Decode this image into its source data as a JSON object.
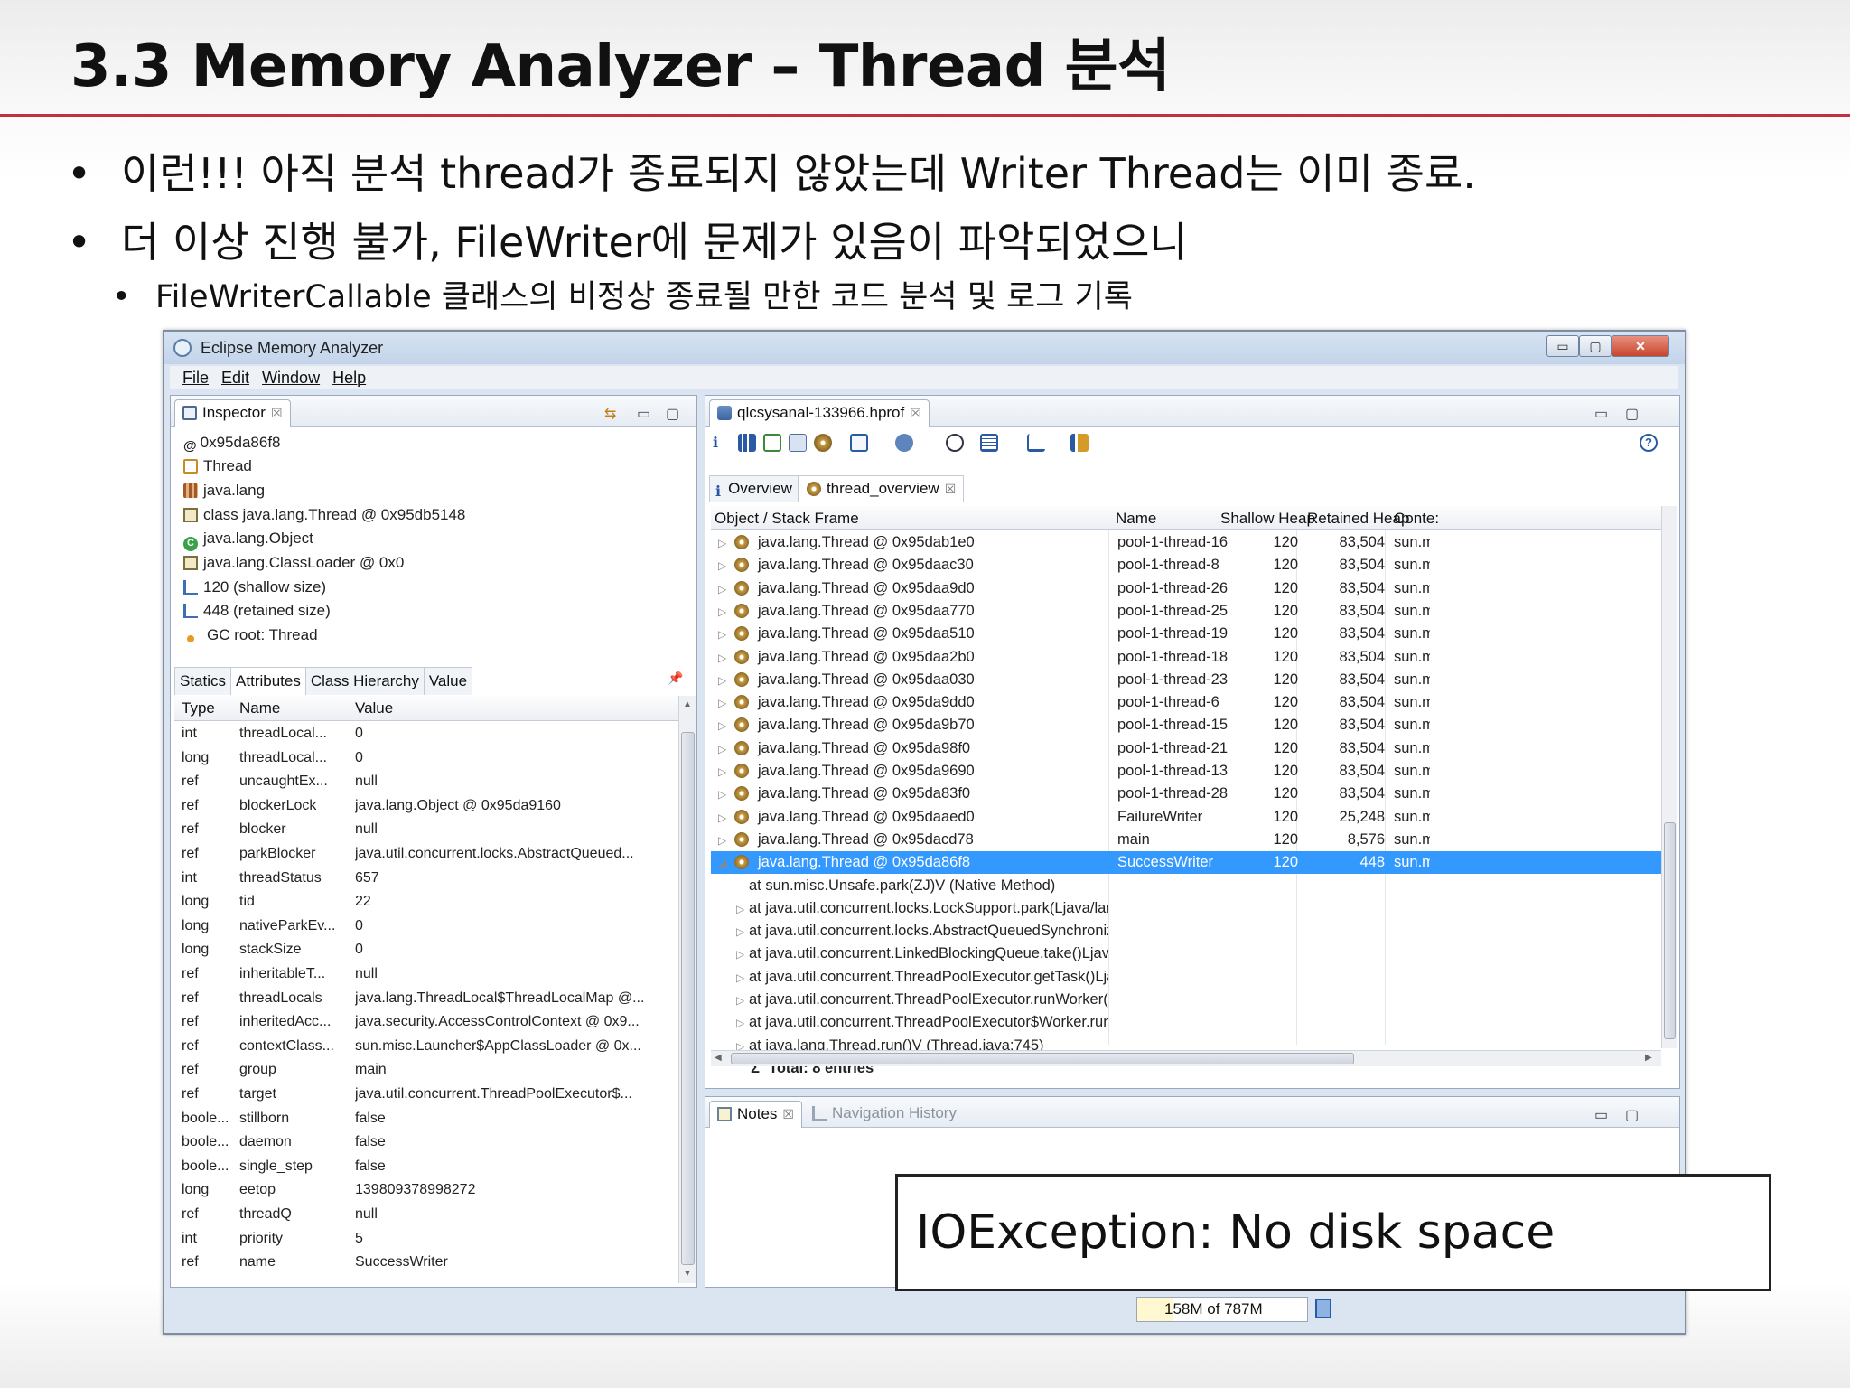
{
  "slide": {
    "title": "3.3 Memory Analyzer – Thread 분석",
    "bullets": [
      "이런!!! 아직 분석 thread가 종료되지 않았는데 Writer Thread는 이미 종료.",
      "더 이상 진행 불가, FileWriter에 문제가 있음이 파악되었으니"
    ],
    "sub_bullet": "FileWriterCallable 클래스의 비정상 종료될 만한 코드 분석 및 로그 기록",
    "bullet_symbol": "•",
    "accent_color": "#c4303d"
  },
  "window": {
    "title": "Eclipse Memory Analyzer",
    "controls": {
      "minimize": "▭",
      "maximize": "▢",
      "close": "✕"
    },
    "menu": [
      "File",
      "Edit",
      "Window",
      "Help"
    ]
  },
  "inspector": {
    "tab_label": "Inspector",
    "items": [
      {
        "icon": "address-icon",
        "glyph": "@",
        "text": "0x95da86f8"
      },
      {
        "icon": "thread-icon",
        "text": "Thread"
      },
      {
        "icon": "package-icon",
        "text": "java.lang"
      },
      {
        "icon": "class-icon",
        "text": "class java.lang.Thread @ 0x95db5148"
      },
      {
        "icon": "object-icon",
        "text": "java.lang.Object"
      },
      {
        "icon": "classloader-icon",
        "text": "java.lang.ClassLoader @ 0x0"
      },
      {
        "icon": "size-icon",
        "text": "120 (shallow size)"
      },
      {
        "icon": "size-icon",
        "text": "448 (retained size)"
      },
      {
        "icon": "gc-root-icon",
        "text": "GC root: Thread"
      }
    ],
    "subtabs": [
      "Statics",
      "Attributes",
      "Class Hierarchy",
      "Value"
    ],
    "active_subtab": "Attributes",
    "columns": [
      "Type",
      "Name",
      "Value"
    ],
    "rows": [
      [
        "int",
        "threadLocal...",
        "0"
      ],
      [
        "long",
        "threadLocal...",
        "0"
      ],
      [
        "ref",
        "uncaughtEx...",
        "null"
      ],
      [
        "ref",
        "blockerLock",
        "java.lang.Object @ 0x95da9160"
      ],
      [
        "ref",
        "blocker",
        "null"
      ],
      [
        "ref",
        "parkBlocker",
        "java.util.concurrent.locks.AbstractQueued..."
      ],
      [
        "int",
        "threadStatus",
        "657"
      ],
      [
        "long",
        "tid",
        "22"
      ],
      [
        "long",
        "nativeParkEv...",
        "0"
      ],
      [
        "long",
        "stackSize",
        "0"
      ],
      [
        "ref",
        "inheritableT...",
        "null"
      ],
      [
        "ref",
        "threadLocals",
        "java.lang.ThreadLocal$ThreadLocalMap @..."
      ],
      [
        "ref",
        "inheritedAcc...",
        "java.security.AccessControlContext @ 0x9..."
      ],
      [
        "ref",
        "contextClass...",
        "sun.misc.Launcher$AppClassLoader @ 0x..."
      ],
      [
        "ref",
        "group",
        "main"
      ],
      [
        "ref",
        "target",
        "java.util.concurrent.ThreadPoolExecutor$..."
      ],
      [
        "boole...",
        "stillborn",
        "false"
      ],
      [
        "boole...",
        "daemon",
        "false"
      ],
      [
        "boole...",
        "single_step",
        "false"
      ],
      [
        "long",
        "eetop",
        "139809378998272"
      ],
      [
        "ref",
        "threadQ",
        "null"
      ],
      [
        "int",
        "priority",
        "5"
      ],
      [
        "ref",
        "name",
        "SuccessWriter"
      ]
    ]
  },
  "editor": {
    "tab_label": "qlcsysanal-133966.hprof",
    "subtabs": [
      "Overview",
      "thread_overview"
    ],
    "active_subtab": "thread_overview",
    "columns": [
      "Object / Stack Frame",
      "Name",
      "Shallow Heap",
      "Retained Heap",
      "Conte:"
    ],
    "threads": [
      {
        "obj": "java.lang.Thread @ 0x95dab1e0",
        "name": "pool-1-thread-16",
        "shallow": "120",
        "retained": "83,504",
        "ctx": "sun.mi"
      },
      {
        "obj": "java.lang.Thread @ 0x95daac30",
        "name": "pool-1-thread-8",
        "shallow": "120",
        "retained": "83,504",
        "ctx": "sun.mi"
      },
      {
        "obj": "java.lang.Thread @ 0x95daa9d0",
        "name": "pool-1-thread-26",
        "shallow": "120",
        "retained": "83,504",
        "ctx": "sun.mi"
      },
      {
        "obj": "java.lang.Thread @ 0x95daa770",
        "name": "pool-1-thread-25",
        "shallow": "120",
        "retained": "83,504",
        "ctx": "sun.mi"
      },
      {
        "obj": "java.lang.Thread @ 0x95daa510",
        "name": "pool-1-thread-19",
        "shallow": "120",
        "retained": "83,504",
        "ctx": "sun.mi"
      },
      {
        "obj": "java.lang.Thread @ 0x95daa2b0",
        "name": "pool-1-thread-18",
        "shallow": "120",
        "retained": "83,504",
        "ctx": "sun.mi"
      },
      {
        "obj": "java.lang.Thread @ 0x95daa030",
        "name": "pool-1-thread-23",
        "shallow": "120",
        "retained": "83,504",
        "ctx": "sun.mi"
      },
      {
        "obj": "java.lang.Thread @ 0x95da9dd0",
        "name": "pool-1-thread-6",
        "shallow": "120",
        "retained": "83,504",
        "ctx": "sun.mi"
      },
      {
        "obj": "java.lang.Thread @ 0x95da9b70",
        "name": "pool-1-thread-15",
        "shallow": "120",
        "retained": "83,504",
        "ctx": "sun.mi"
      },
      {
        "obj": "java.lang.Thread @ 0x95da98f0",
        "name": "pool-1-thread-21",
        "shallow": "120",
        "retained": "83,504",
        "ctx": "sun.mi"
      },
      {
        "obj": "java.lang.Thread @ 0x95da9690",
        "name": "pool-1-thread-13",
        "shallow": "120",
        "retained": "83,504",
        "ctx": "sun.mi"
      },
      {
        "obj": "java.lang.Thread @ 0x95da83f0",
        "name": "pool-1-thread-28",
        "shallow": "120",
        "retained": "83,504",
        "ctx": "sun.mi"
      },
      {
        "obj": "java.lang.Thread @ 0x95daaed0",
        "name": "FailureWriter",
        "shallow": "120",
        "retained": "25,248",
        "ctx": "sun.mi"
      },
      {
        "obj": "java.lang.Thread @ 0x95dacd78",
        "name": "main",
        "shallow": "120",
        "retained": "8,576",
        "ctx": "sun.mi"
      }
    ],
    "selected": {
      "obj": "java.lang.Thread @ 0x95da86f8",
      "name": "SuccessWriter",
      "shallow": "120",
      "retained": "448",
      "ctx": "sun.mi"
    },
    "frames": [
      {
        "text": "at sun.misc.Unsafe.park(ZJ)V (Native Method)",
        "expandable": false
      },
      {
        "text": "at java.util.concurrent.locks.LockSupport.park(Ljava/lang/Object;)V (L",
        "expandable": true
      },
      {
        "text": "at java.util.concurrent.locks.AbstractQueuedSynchronizer$ConditionC",
        "expandable": true
      },
      {
        "text": "at java.util.concurrent.LinkedBlockingQueue.take()Ljava/lang/Object;",
        "expandable": true
      },
      {
        "text": "at java.util.concurrent.ThreadPoolExecutor.getTask()Ljava/lang/Runna",
        "expandable": true
      },
      {
        "text": "at java.util.concurrent.ThreadPoolExecutor.runWorker(Ljava/util/concu",
        "expandable": true
      },
      {
        "text": "at java.util.concurrent.ThreadPoolExecutor$Worker.run()V (ThreadPoo",
        "expandable": true
      },
      {
        "text": "at java.lang.Thread.run()V (Thread.java:745)",
        "expandable": true
      }
    ],
    "total": "Total: 8 entries",
    "total_symbol": "Σ"
  },
  "notes": {
    "tab_label": "Notes",
    "nav_tab_label": "Navigation History"
  },
  "status": {
    "heap": "158M of 787M"
  },
  "callout": {
    "text": "IOException: No disk space"
  },
  "glyphs": {
    "close": "☒",
    "minimize": "▭",
    "maximize": "▢",
    "expand": "▷",
    "collapse": "◢",
    "scroll_up": "▲",
    "scroll_down": "▼",
    "scroll_left": "◀",
    "scroll_right": "▶",
    "pin": "📌",
    "help": "?"
  }
}
